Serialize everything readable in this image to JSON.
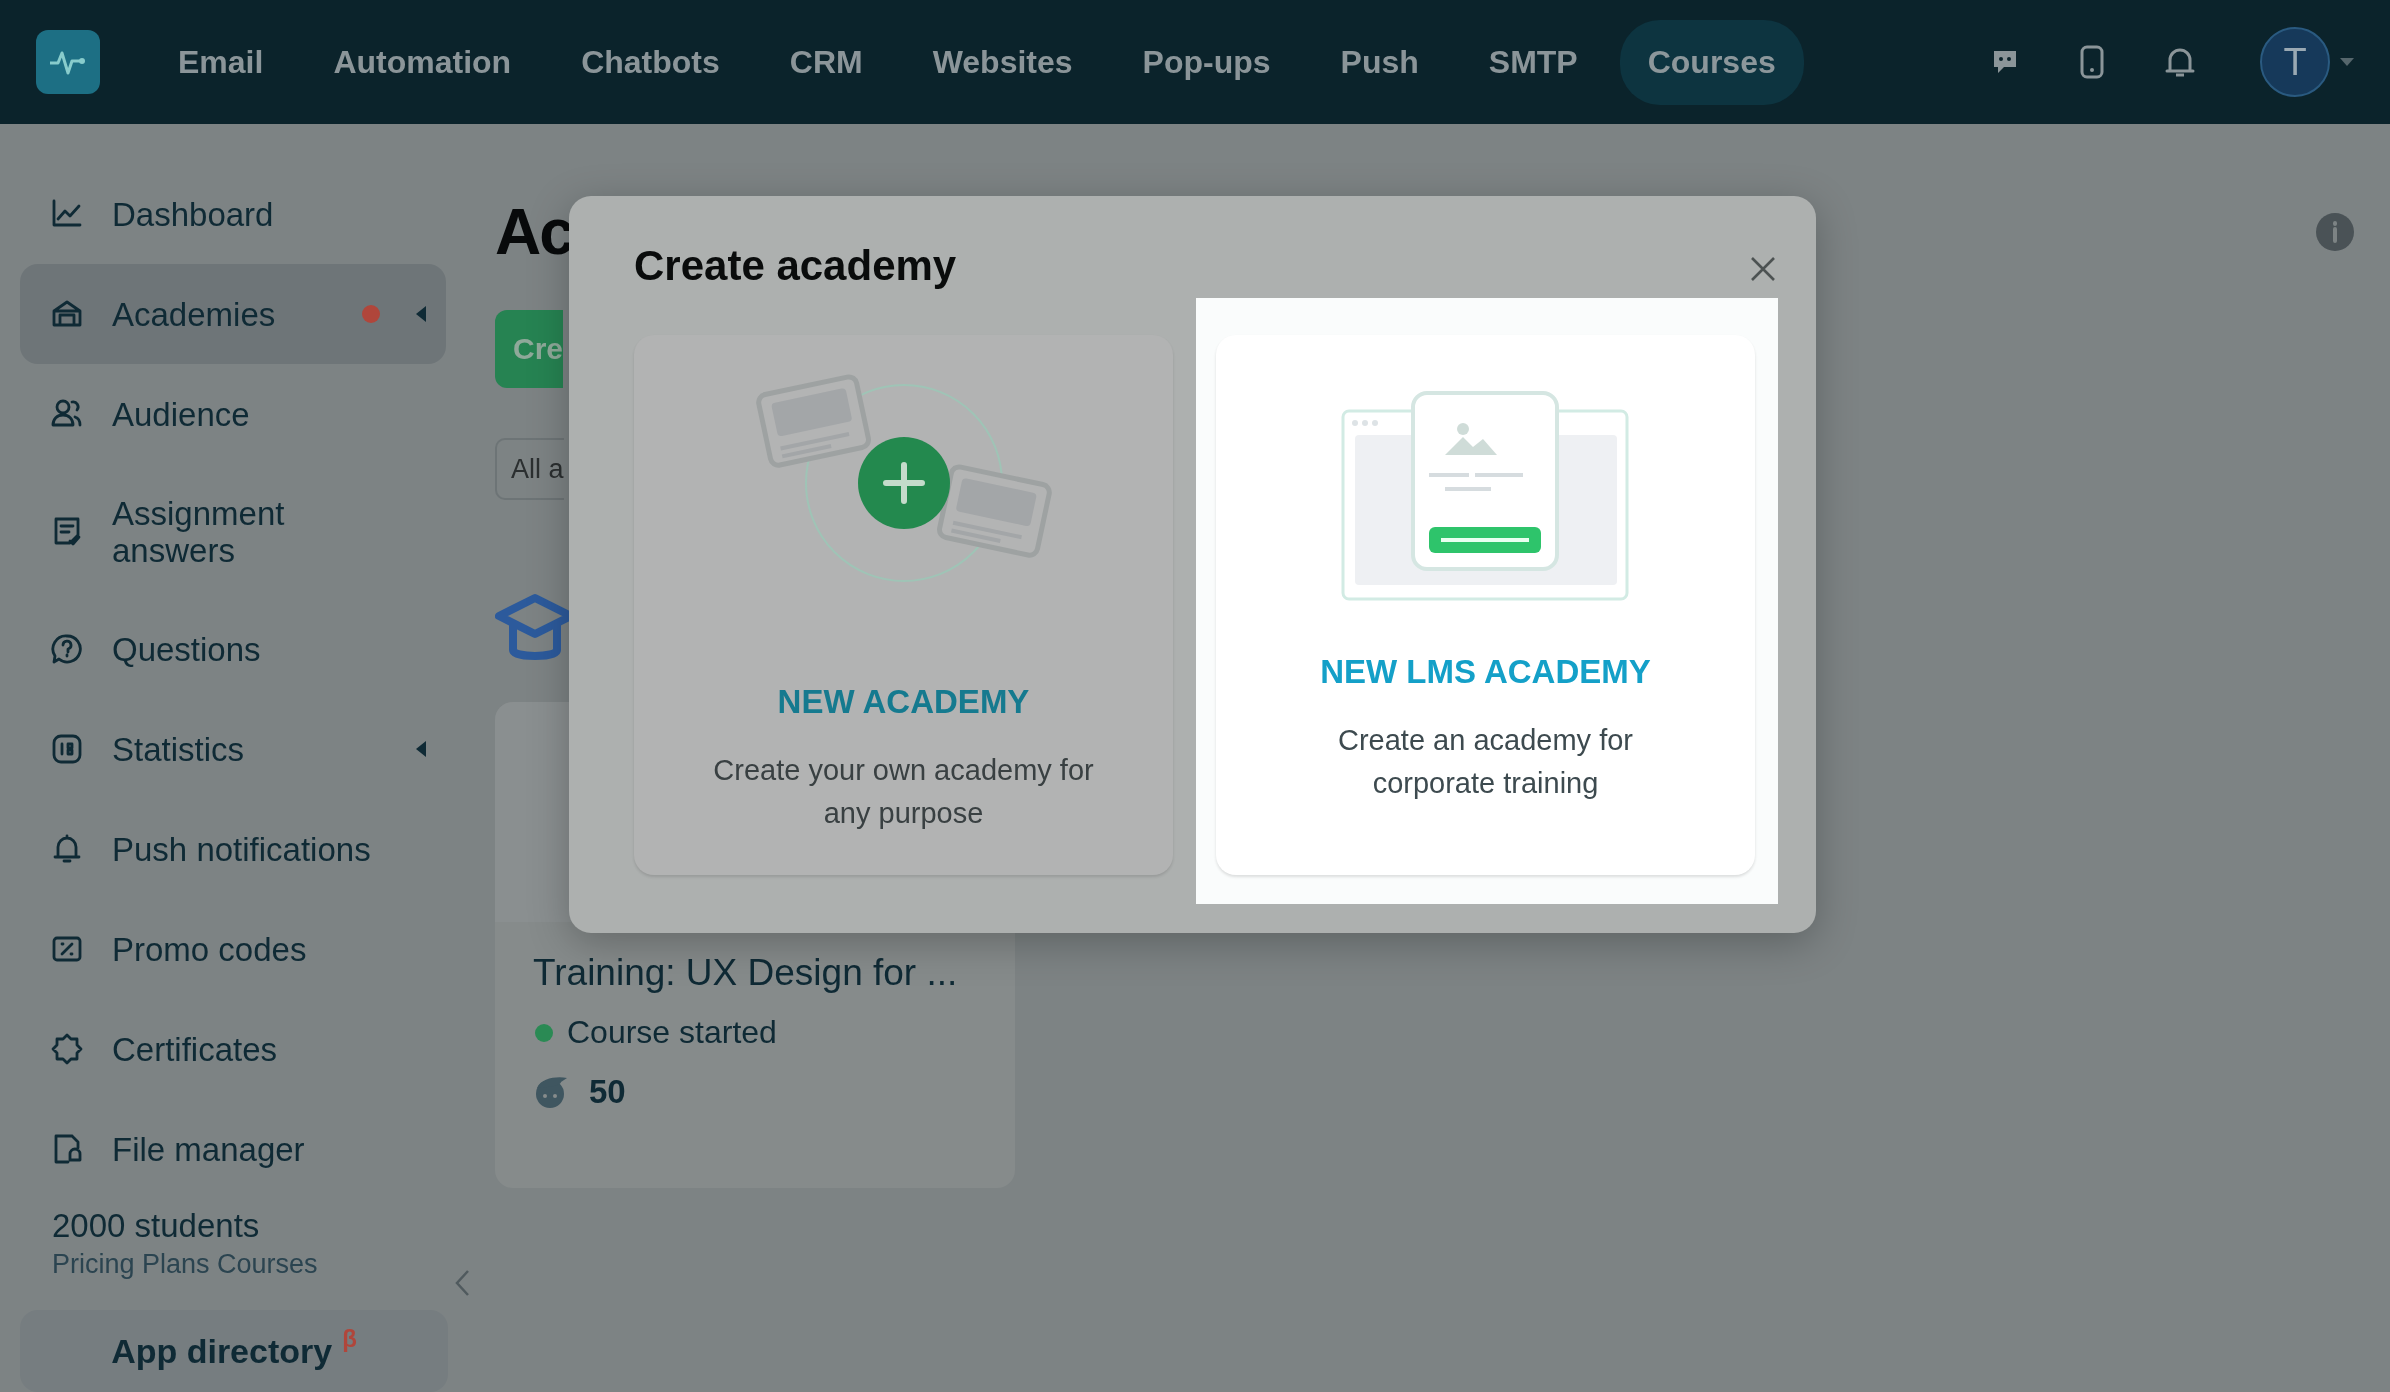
{
  "topbar": {
    "nav": [
      {
        "label": "Email",
        "selected": false
      },
      {
        "label": "Automation",
        "selected": false
      },
      {
        "label": "Chatbots",
        "selected": false
      },
      {
        "label": "CRM",
        "selected": false
      },
      {
        "label": "Websites",
        "selected": false
      },
      {
        "label": "Pop-ups",
        "selected": false
      },
      {
        "label": "Push",
        "selected": false
      },
      {
        "label": "SMTP",
        "selected": false
      },
      {
        "label": "Courses",
        "selected": true
      }
    ],
    "avatar_initial": "T"
  },
  "sidebar": {
    "items": [
      {
        "label": "Dashboard",
        "selected": false,
        "notification": false,
        "has_submenu": false
      },
      {
        "label": "Academies",
        "selected": true,
        "notification": true,
        "has_submenu": true
      },
      {
        "label": "Audience",
        "selected": false,
        "notification": false,
        "has_submenu": false
      },
      {
        "label": "Assignment answers",
        "selected": false,
        "notification": false,
        "has_submenu": false
      },
      {
        "label": "Questions",
        "selected": false,
        "notification": false,
        "has_submenu": false
      },
      {
        "label": "Statistics",
        "selected": false,
        "notification": false,
        "has_submenu": true
      },
      {
        "label": "Push notifications",
        "selected": false,
        "notification": false,
        "has_submenu": false
      },
      {
        "label": "Promo codes",
        "selected": false,
        "notification": false,
        "has_submenu": false
      },
      {
        "label": "Certificates",
        "selected": false,
        "notification": false,
        "has_submenu": false
      },
      {
        "label": "File manager",
        "selected": false,
        "notification": false,
        "has_submenu": false
      }
    ],
    "plan": {
      "title": "2000 students",
      "subtitle": "Pricing Plans Courses"
    },
    "app_directory": {
      "label": "App directory",
      "badge": "β"
    }
  },
  "main": {
    "heading": "Ac",
    "create_button": "Cre",
    "filter": "All a",
    "course_card": {
      "title": "Training: UX Design for ...",
      "status": "Course started",
      "students": "50"
    }
  },
  "modal": {
    "title": "Create academy",
    "options": [
      {
        "title": "NEW ACADEMY",
        "description": "Create your own academy for any purpose",
        "highlighted": false
      },
      {
        "title": "NEW LMS ACADEMY",
        "description": "Create an academy for corporate training",
        "highlighted": true
      }
    ]
  }
}
